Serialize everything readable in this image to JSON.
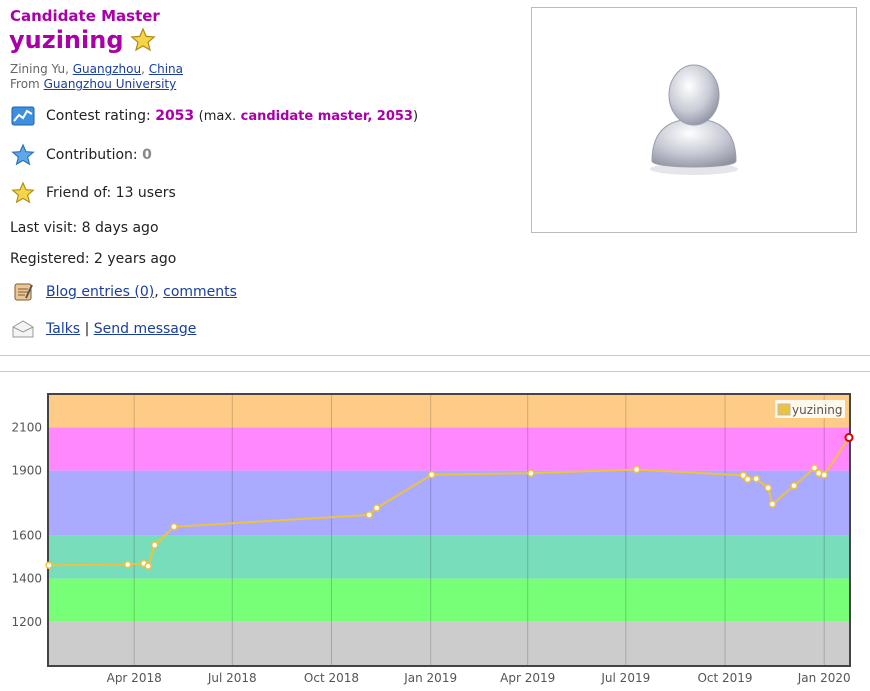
{
  "profile": {
    "rank": "Candidate Master",
    "handle": "yuzining",
    "name_prefix": "Zining Yu,",
    "city": "Guangzhou",
    "country": "China",
    "from_label": "From",
    "organization": "Guangzhou University",
    "rating_label": "Contest rating:",
    "rating": "2053",
    "max_prefix": "(max.",
    "max_rank": "candidate master, 2053",
    "max_suffix": ")",
    "contribution_label": "Contribution:",
    "contribution": "0",
    "friend_of": "Friend of: 13 users",
    "last_visit": "Last visit: 8 days ago",
    "registered": "Registered: 2 years ago",
    "blog_link": "Blog entries (0)",
    "comments_link": "comments",
    "talks_link": "Talks",
    "separator": "|",
    "send_message_link": "Send message"
  },
  "colors": {
    "rank_purple": "#aa00aa",
    "link_blue": "#1a3ea0",
    "series_line": "#edc240"
  },
  "chart_data": {
    "type": "line",
    "legend_position": "top-right",
    "grid": true,
    "ylim": [
      1000,
      2250
    ],
    "yticks": [
      1200,
      1400,
      1600,
      1900,
      2100
    ],
    "x_tick_labels": [
      "Apr 2018",
      "Jul 2018",
      "Oct 2018",
      "Jan 2019",
      "Apr 2019",
      "Jul 2019",
      "Oct 2019",
      "Jan 2020"
    ],
    "x_tick_dates": [
      "2018-04-01",
      "2018-07-01",
      "2018-10-01",
      "2019-01-01",
      "2019-04-01",
      "2019-07-01",
      "2019-10-01",
      "2020-01-01"
    ],
    "xlim": [
      "2018-01-12",
      "2020-01-24"
    ],
    "bands": [
      {
        "from": 1000,
        "to": 1200,
        "color": "#cccccc"
      },
      {
        "from": 1200,
        "to": 1400,
        "color": "#77ff77"
      },
      {
        "from": 1400,
        "to": 1600,
        "color": "#77ddbb"
      },
      {
        "from": 1600,
        "to": 1900,
        "color": "#aaaaff"
      },
      {
        "from": 1900,
        "to": 2100,
        "color": "#ff88ff"
      },
      {
        "from": 2100,
        "to": 2250,
        "color": "#ffcc88"
      }
    ],
    "series": [
      {
        "name": "yuzining",
        "color": "#edc240",
        "points": [
          [
            "2018-01-12",
            1462
          ],
          [
            "2018-03-26",
            1465
          ],
          [
            "2018-04-10",
            1470
          ],
          [
            "2018-04-14",
            1458
          ],
          [
            "2018-04-20",
            1555
          ],
          [
            "2018-05-08",
            1640
          ],
          [
            "2018-11-05",
            1695
          ],
          [
            "2018-11-12",
            1727
          ],
          [
            "2019-01-02",
            1881
          ],
          [
            "2019-04-04",
            1888
          ],
          [
            "2019-07-11",
            1905
          ],
          [
            "2019-10-18",
            1878
          ],
          [
            "2019-10-22",
            1860
          ],
          [
            "2019-10-30",
            1862
          ],
          [
            "2019-11-10",
            1820
          ],
          [
            "2019-11-14",
            1745
          ],
          [
            "2019-12-04",
            1830
          ],
          [
            "2019-12-23",
            1912
          ],
          [
            "2019-12-27",
            1888
          ],
          [
            "2020-01-01",
            1880
          ],
          [
            "2020-01-24",
            2053
          ]
        ]
      }
    ]
  }
}
